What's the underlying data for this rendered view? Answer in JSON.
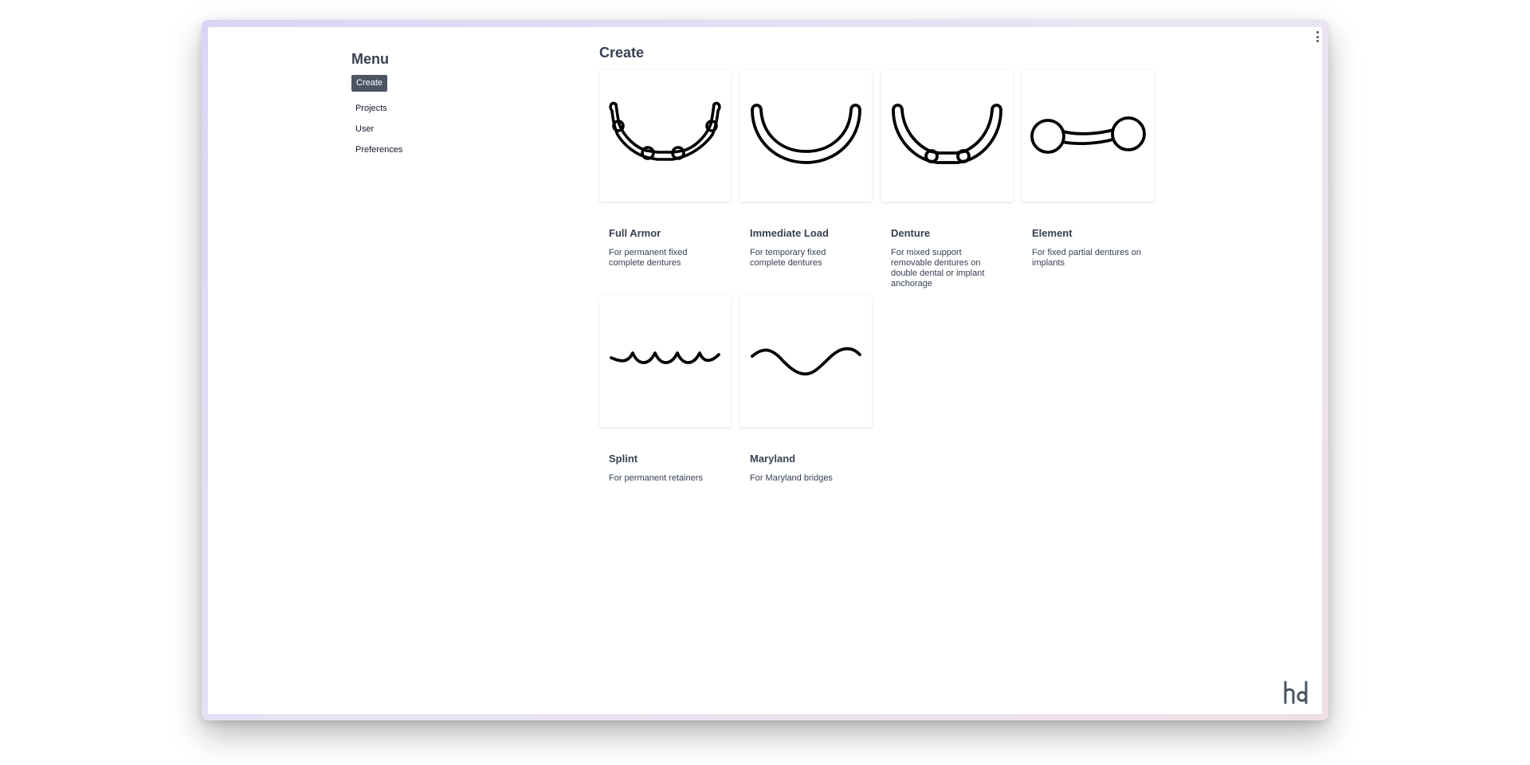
{
  "sidebar": {
    "title": "Menu",
    "active_button": "Create",
    "items": [
      {
        "label": "Projects"
      },
      {
        "label": "User"
      },
      {
        "label": "Preferences"
      }
    ]
  },
  "main": {
    "title": "Create",
    "cards": [
      {
        "name": "Full Armor",
        "description": "For permanent fixed complete dentures",
        "icon": "full-armor-arch-icon"
      },
      {
        "name": "Immediate Load",
        "description": "For temporary fixed complete dentures",
        "icon": "immediate-load-arch-icon"
      },
      {
        "name": "Denture",
        "description": "For mixed support removable dentures on double dental or implant anchorage",
        "icon": "denture-arch-icon"
      },
      {
        "name": "Element",
        "description": "For fixed partial dentures on implants",
        "icon": "element-bar-icon"
      },
      {
        "name": "Splint",
        "description": "For permanent retainers",
        "icon": "splint-wave-icon"
      },
      {
        "name": "Maryland",
        "description": "For Maryland bridges",
        "icon": "maryland-curve-icon"
      }
    ]
  },
  "window": {
    "menu_icon": "vertical-dots-icon",
    "logo_icon": "hd-logo-icon"
  },
  "colors": {
    "button_bg": "#4b5563",
    "text": "#374151",
    "frame_gradient_start": "#d9d5f5",
    "frame_gradient_end": "#f0dfe6"
  }
}
